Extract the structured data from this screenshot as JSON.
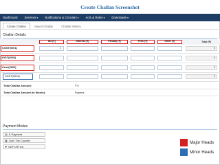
{
  "page_title": "Create Challan Screenshot",
  "navbar": {
    "items": [
      "Dashboard",
      "Services",
      "Notifications & Circulars",
      "Acts & Rules",
      "Downloads"
    ]
  },
  "tabs": [
    "Create Challan",
    "Saved Challan",
    "Challan History"
  ],
  "challan_details": {
    "heading": "Challan Details",
    "columns": [
      "Tax (₹)",
      "Interest (₹)",
      "Penalty (₹)",
      "Fees (₹)",
      "Other (₹)",
      "Total (₹)"
    ],
    "rows": [
      {
        "label": "CGST(0001)",
        "total": "0"
      },
      {
        "label": "IGST(0002)",
        "total": "0"
      },
      {
        "label": "Cess(0003)",
        "total": "0"
      },
      {
        "label": "SGST(0004)",
        "total": "0"
      }
    ],
    "total_amount_label": "Total Challan Amount:",
    "total_amount_value": "₹ 0",
    "total_words_label": "Total Challan Amount (In Words):",
    "total_words_value": "Rupees"
  },
  "payment_modes": {
    "heading": "Payment Modes",
    "options": [
      "E-Payment",
      "Over The Counter",
      "NEFT/RTGS"
    ]
  },
  "legend": [
    {
      "label": "Major Heads",
      "color": "#d52020"
    },
    {
      "label": "Minor Heads",
      "color": "#2f6db5"
    }
  ],
  "colors": {
    "navbar": "#1e3d64",
    "title": "#2e6da4"
  }
}
